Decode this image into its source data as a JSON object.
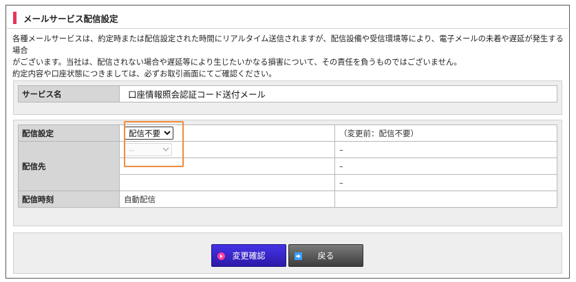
{
  "section": {
    "title": "メールサービス配信設定",
    "accent_color": "#e8365a"
  },
  "description": {
    "line1": "各種メールサービスは、約定時または配信設定された時間にリアルタイム送信されますが、配信設備や受信環境等により、電子メールの未着や遅延が発生する場合",
    "line2": "がございます。当社は、配信されない場合や遅延等により生じたいかなる損害について、その責任を負うものではございません。",
    "line3": "約定内容や口座状態につきましては、必ずお取引画面にてご確認ください。"
  },
  "service": {
    "label": "サービス名",
    "value": "口座情報照会認証コード送付メール"
  },
  "settings": {
    "delivery_label": "配信設定",
    "delivery_selected": "配信不要",
    "delivery_previous": "（変更前：配信不要）",
    "destination_label": "配信先",
    "destination_selected": "--",
    "destination_values": [
      "–",
      "–",
      "–"
    ],
    "timing_label": "配信時刻",
    "timing_value": "自動配信"
  },
  "buttons": {
    "confirm_label": "変更確認",
    "back_label": "戻る",
    "confirm_icon": "circle-arrow-icon",
    "back_icon": "arrow-right-icon"
  }
}
